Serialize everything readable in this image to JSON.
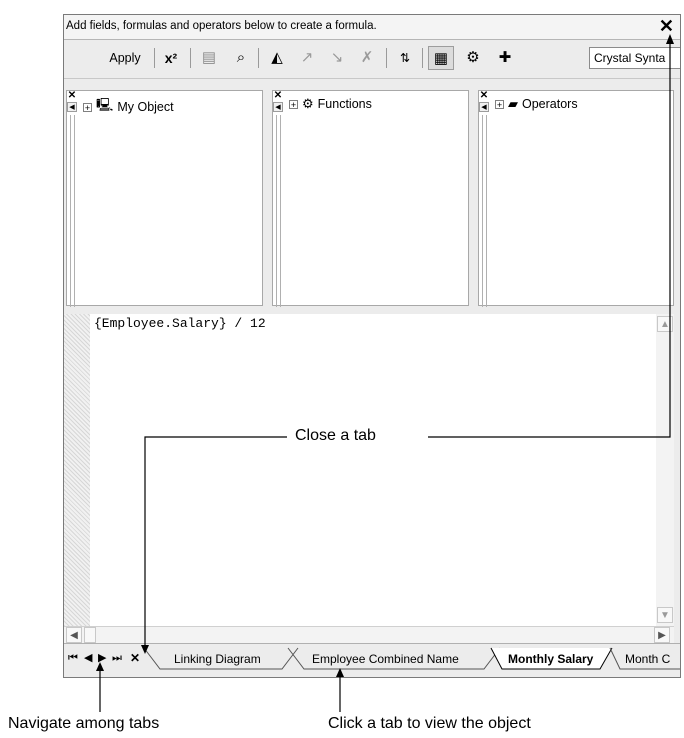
{
  "window": {
    "hint": "Add fields, formulas and operators below to create a formula.",
    "close_glyph": "✕"
  },
  "toolbar": {
    "apply_label": "Apply",
    "syntax_value": "Crystal Synta"
  },
  "panes": [
    {
      "label": "My Object"
    },
    {
      "label": "Functions"
    },
    {
      "label": "Operators"
    }
  ],
  "editor": {
    "formula": "{Employee.Salary} / 12"
  },
  "tabs": [
    {
      "label": "Linking Diagram"
    },
    {
      "label": "Employee Combined Name"
    },
    {
      "label": "Monthly Salary"
    },
    {
      "label": "Month C"
    }
  ],
  "annotations": {
    "close_tab": "Close a tab",
    "navigate": "Navigate among tabs",
    "click_tab": "Click a tab to view the object"
  }
}
